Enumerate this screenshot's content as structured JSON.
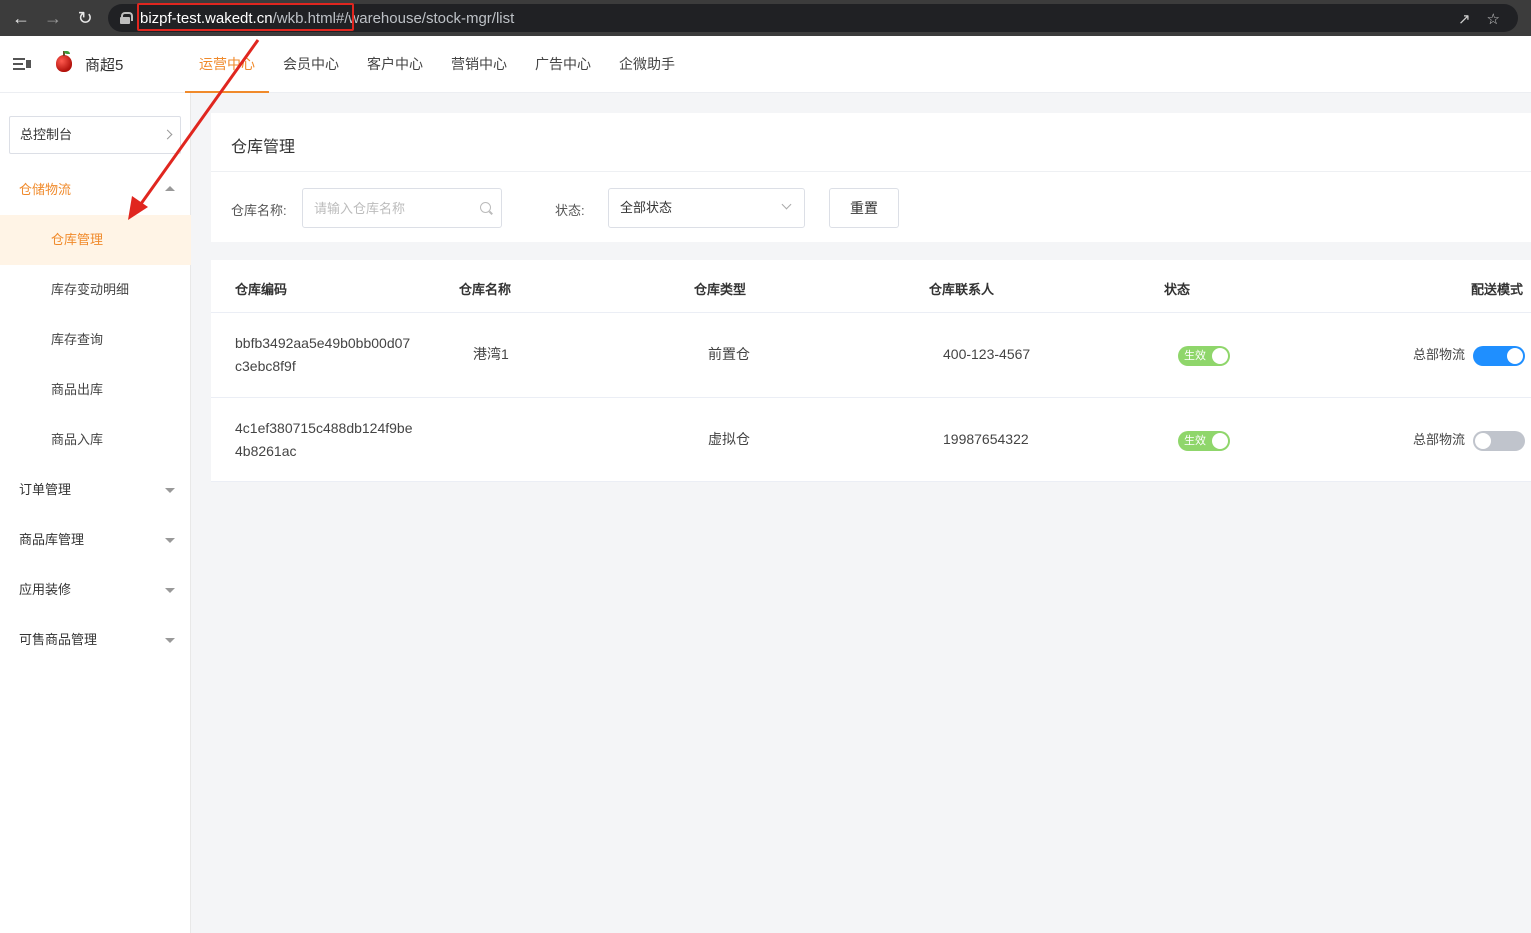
{
  "browser": {
    "url_host": "bizpf-test.wakedt.cn",
    "url_path": "/wkb.html#/warehouse/stock-mgr/list"
  },
  "header": {
    "brand": "商超5",
    "tabs": [
      "运营中心",
      "会员中心",
      "客户中心",
      "营销中心",
      "广告中心",
      "企微助手"
    ],
    "active_tab": "运营中心"
  },
  "sidebar": {
    "dashboard": "总控制台",
    "groups": [
      {
        "label": "仓储物流",
        "expanded": true,
        "items": [
          "仓库管理",
          "库存变动明细",
          "库存查询",
          "商品出库",
          "商品入库"
        ],
        "active_item": "仓库管理"
      },
      {
        "label": "订单管理",
        "expanded": false
      },
      {
        "label": "商品库管理",
        "expanded": false
      },
      {
        "label": "应用装修",
        "expanded": false
      },
      {
        "label": "可售商品管理",
        "expanded": false
      }
    ]
  },
  "page": {
    "title": "仓库管理",
    "filters": {
      "name_label": "仓库名称:",
      "name_placeholder": "请输入仓库名称",
      "status_label": "状态:",
      "status_value": "全部状态",
      "reset_label": "重置"
    }
  },
  "table": {
    "columns": [
      "仓库编码",
      "仓库名称",
      "仓库类型",
      "仓库联系人",
      "状态",
      "配送模式"
    ],
    "rows": [
      {
        "code_line1": "bbfb3492aa5e49b0bb00d07",
        "code_line2": "c3ebc8f9f",
        "name": "港湾1",
        "type": "前置仓",
        "contact": "400-123-4567",
        "status_label": "生效",
        "status_on": true,
        "delivery_label": "总部物流",
        "delivery_on": true
      },
      {
        "code_line1": "4c1ef380715c488db124f9be",
        "code_line2": "4b8261ac",
        "name": "",
        "type": "虚拟仓",
        "contact": "19987654322",
        "status_label": "生效",
        "status_on": true,
        "delivery_label": "总部物流",
        "delivery_on": false
      }
    ]
  },
  "colors": {
    "accent": "#f08a2b",
    "active_bg": "#fff4e6",
    "switch_on_status": "#8fd66b",
    "switch_on_delivery": "#1f8fff",
    "switch_off": "#c0c4cc",
    "annotation": "#e0261f"
  }
}
